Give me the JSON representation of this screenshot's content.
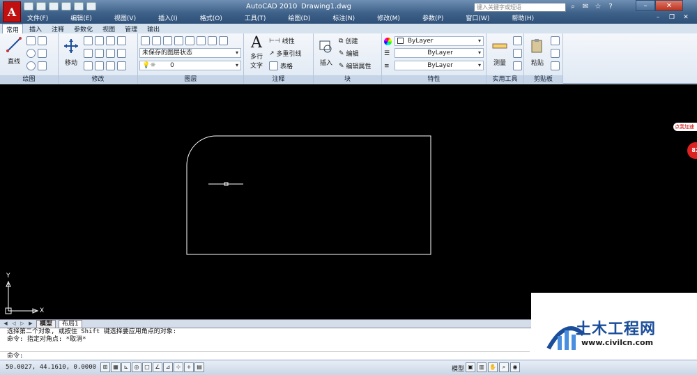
{
  "app": {
    "title": "AutoCAD 2010",
    "filename": "Drawing1.dwg",
    "logo": "A",
    "search_placeholder": "键入关键字或短语"
  },
  "menubar": [
    "文件(F)",
    "编辑(E)",
    "视图(V)",
    "插入(I)",
    "格式(O)",
    "工具(T)",
    "绘图(D)",
    "标注(N)",
    "修改(M)",
    "参数(P)",
    "窗口(W)",
    "帮助(H)"
  ],
  "ribbon_tabs": [
    {
      "label": "常用",
      "active": true
    },
    {
      "label": "插入",
      "active": false
    },
    {
      "label": "注释",
      "active": false
    },
    {
      "label": "参数化",
      "active": false
    },
    {
      "label": "视图",
      "active": false
    },
    {
      "label": "管理",
      "active": false
    },
    {
      "label": "输出",
      "active": false
    }
  ],
  "panels": {
    "draw": {
      "title": "绘图",
      "line_label": "直线"
    },
    "modify": {
      "title": "修改",
      "move_label": "移动"
    },
    "layers": {
      "title": "图层",
      "layer_state": "未保存的图层状态",
      "current_layer": "0"
    },
    "annotation": {
      "title": "注释",
      "mtext_label_1": "多行",
      "mtext_label_2": "文字",
      "linear": "线性",
      "multileader": "多重引线",
      "table": "表格"
    },
    "block": {
      "title": "块",
      "insert": "插入",
      "create": "创建",
      "edit": "编辑",
      "edit_attrib": "编辑属性"
    },
    "properties": {
      "title": "特性",
      "color": "ByLayer",
      "linetype": "ByLayer",
      "lineweight": "ByLayer"
    },
    "utilities": {
      "title": "实用工具",
      "measure": "测量"
    },
    "clipboard": {
      "title": "剪贴板",
      "paste": "粘贴"
    }
  },
  "layout_tabs": [
    {
      "label": "模型",
      "active": true
    },
    {
      "label": "布局1",
      "active": false
    }
  ],
  "command": {
    "history": [
      "选择第二个对象, 或按住 Shift 键选择要应用角点的对象:",
      "命令: 指定对角点: *取消*"
    ],
    "prompt": "命令:"
  },
  "status": {
    "coords": "50.0027, 44.1610, 0.0000",
    "model_label": "模型"
  },
  "ucs": {
    "x_label": "X",
    "y_label": "Y"
  },
  "watermark": {
    "title": "土木工程网",
    "url": "www.civilcn.com"
  },
  "side_badge": {
    "label": "点我加速",
    "number": "82"
  },
  "colors": {
    "canvas": "#000000",
    "ribbon": "#dfe8f3",
    "titlebar": "#3e6189",
    "watermark_blue": "#1a4d9a"
  }
}
